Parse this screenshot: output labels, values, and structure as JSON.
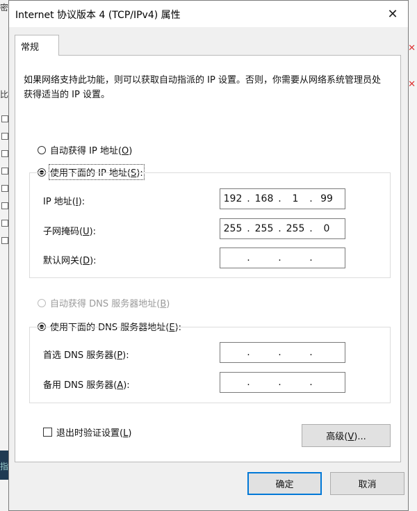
{
  "window": {
    "title": "Internet 协议版本 4 (TCP/IPv4) 属性"
  },
  "tabs": [
    {
      "label": "常规"
    }
  ],
  "description": "如果网络支持此功能，则可以获取自动指派的 IP 设置。否则，你需要从网络系统管理员处获得适当的 IP 设置。",
  "ip_section": {
    "auto_label": "自动获得 IP 地址(",
    "auto_key": "O",
    "manual_label": "使用下面的 IP 地址(",
    "manual_key": "S",
    "manual_selected": true,
    "ip_label": "IP 地址(",
    "ip_key": "I",
    "ip_octets": [
      "192",
      "168",
      "1",
      "99"
    ],
    "mask_label": "子网掩码(",
    "mask_key": "U",
    "mask_octets": [
      "255",
      "255",
      "255",
      "0"
    ],
    "gateway_label": "默认网关(",
    "gateway_key": "D",
    "gateway_octets": [
      "",
      "",
      "",
      ""
    ]
  },
  "dns_section": {
    "auto_label": "自动获得 DNS 服务器地址(",
    "auto_key": "B",
    "manual_label": "使用下面的 DNS 服务器地址(",
    "manual_key": "E",
    "preferred_label": "首选 DNS 服务器(",
    "preferred_key": "P",
    "preferred_octets": [
      "",
      "",
      "",
      ""
    ],
    "alternate_label": "备用 DNS 服务器(",
    "alternate_key": "A",
    "alternate_octets": [
      "",
      "",
      "",
      ""
    ]
  },
  "validate": {
    "label": "退出时验证设置(",
    "key": "L",
    "checked": false
  },
  "buttons": {
    "advanced_label": "高级(",
    "advanced_key": "V",
    "advanced_suffix": ")...",
    "ok": "确定",
    "cancel": "取消"
  },
  "background": {
    "left_chars": [
      "密",
      "比"
    ],
    "left_bottom": "指"
  }
}
